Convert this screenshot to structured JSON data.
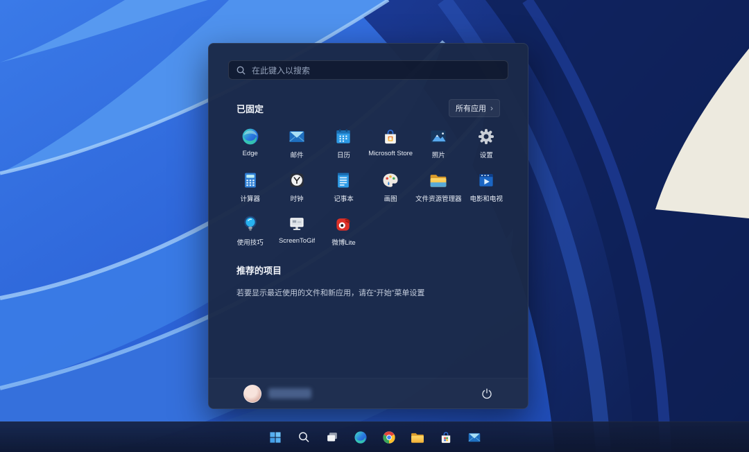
{
  "start_menu": {
    "search_placeholder": "在此键入以搜索",
    "pinned_title": "已固定",
    "all_apps_label": "所有应用",
    "all_apps_chevron": "›",
    "apps": [
      {
        "label": "Edge",
        "icon": "edge-icon"
      },
      {
        "label": "邮件",
        "icon": "mail-icon"
      },
      {
        "label": "日历",
        "icon": "calendar-icon"
      },
      {
        "label": "Microsoft Store",
        "icon": "store-icon"
      },
      {
        "label": "照片",
        "icon": "photos-icon"
      },
      {
        "label": "设置",
        "icon": "settings-gear-icon"
      },
      {
        "label": "计算器",
        "icon": "calculator-icon"
      },
      {
        "label": "时钟",
        "icon": "clock-icon"
      },
      {
        "label": "记事本",
        "icon": "notepad-icon"
      },
      {
        "label": "画图",
        "icon": "paint-icon"
      },
      {
        "label": "文件资源管理器",
        "icon": "file-explorer-icon"
      },
      {
        "label": "电影和电视",
        "icon": "movies-tv-icon"
      },
      {
        "label": "使用技巧",
        "icon": "tips-icon"
      },
      {
        "label": "ScreenToGif",
        "icon": "screentogif-icon"
      },
      {
        "label": "微博Lite",
        "icon": "weibo-lite-icon"
      }
    ],
    "recommended_title": "推荐的项目",
    "recommended_empty_text": "若要显示最近使用的文件和新应用，请在“开始”菜单设置",
    "user": {
      "name_redacted": true
    }
  },
  "taskbar": {
    "items": [
      {
        "icon": "start-icon"
      },
      {
        "icon": "search-icon"
      },
      {
        "icon": "task-view-icon"
      },
      {
        "icon": "edge-icon"
      },
      {
        "icon": "chrome-icon"
      },
      {
        "icon": "file-explorer-icon"
      },
      {
        "icon": "store-icon"
      },
      {
        "icon": "mail-icon"
      }
    ]
  },
  "colors": {
    "menu_bg": "#1b2948",
    "taskbar_bg": "#131e3d",
    "wallpaper_blue": "#2f6de0",
    "wallpaper_navy": "#11245e",
    "start_logo_blue": "#55aef0",
    "folder_yellow": "#ffd257",
    "weibo_red": "#dd3128"
  }
}
